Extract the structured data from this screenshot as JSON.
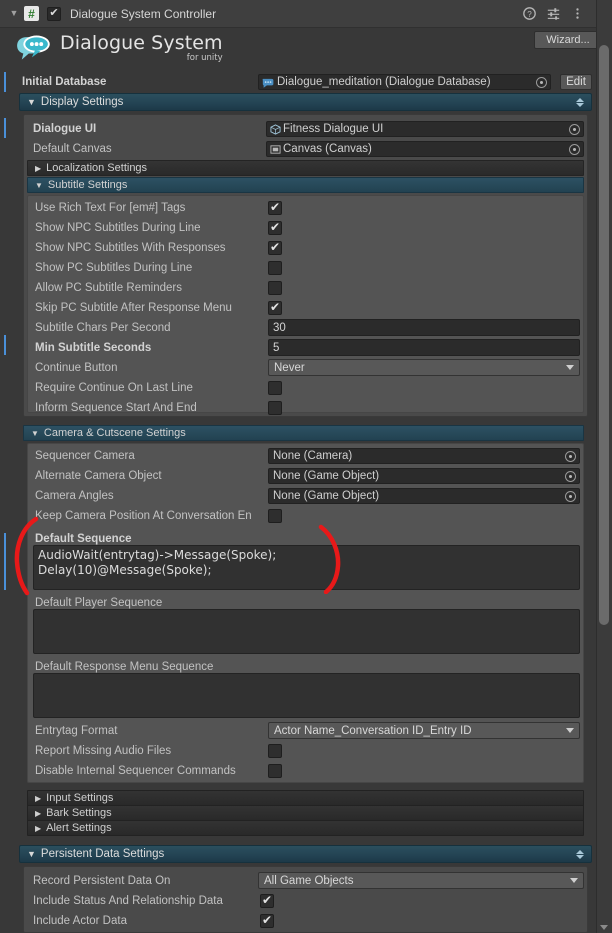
{
  "component": {
    "title": "Dialogue System Controller",
    "script_icon": "csharp-script-icon",
    "enabled": true,
    "help_icon": "help-icon",
    "preset_icon": "preset-settings-icon",
    "menu_icon": "kebab-menu-icon"
  },
  "logo": {
    "main": "Dialogue System",
    "sub": "for unity",
    "icon": "speech-bubble-logo"
  },
  "wizard_button": "Wizard...",
  "initial_database": {
    "label": "Initial Database",
    "value": "Dialogue_meditation (Dialogue Database)",
    "asset_icon": "dialogue-database-icon",
    "edit_button": "Edit"
  },
  "display_settings": {
    "header": "Display Settings",
    "dialogue_ui": {
      "label": "Dialogue UI",
      "value": "Fitness Dialogue UI",
      "icon": "prefab-icon"
    },
    "default_canvas": {
      "label": "Default Canvas",
      "value": "Canvas (Canvas)",
      "icon": "gameobject-icon"
    },
    "localization_settings": "Localization Settings",
    "subtitle_settings": "Subtitle Settings",
    "subtitle_rows": [
      {
        "label": "Use Rich Text For [em#] Tags",
        "type": "checkbox",
        "value": true
      },
      {
        "label": "Show NPC Subtitles During Line",
        "type": "checkbox",
        "value": true
      },
      {
        "label": "Show NPC Subtitles With Responses",
        "type": "checkbox",
        "value": true
      },
      {
        "label": "Show PC Subtitles During Line",
        "type": "checkbox",
        "value": false
      },
      {
        "label": "Allow PC Subtitle Reminders",
        "type": "checkbox",
        "value": false
      },
      {
        "label": "Skip PC Subtitle After Response Menu",
        "type": "checkbox",
        "value": true
      },
      {
        "label": "Subtitle Chars Per Second",
        "type": "text",
        "value": "30"
      },
      {
        "label": "Min Subtitle Seconds",
        "type": "text",
        "value": "5",
        "bold": true
      },
      {
        "label": "Continue Button",
        "type": "popup",
        "value": "Never"
      },
      {
        "label": "Require Continue On Last Line",
        "type": "checkbox",
        "value": false
      },
      {
        "label": "Inform Sequence Start And End",
        "type": "checkbox",
        "value": false
      }
    ]
  },
  "camera_settings": {
    "header": "Camera & Cutscene Settings",
    "sequencer_camera": {
      "label": "Sequencer Camera",
      "value": "None (Camera)"
    },
    "alternate_camera_object": {
      "label": "Alternate Camera Object",
      "value": "None (Game Object)"
    },
    "camera_angles": {
      "label": "Camera Angles",
      "value": "None (Game Object)"
    },
    "keep_camera_position": {
      "label": "Keep Camera Position At Conversation En",
      "value": false
    },
    "default_sequence": {
      "label": "Default Sequence",
      "value": "AudioWait(entrytag)->Message(Spoke);\nDelay(10)@Message(Spoke);",
      "line1": "AudioWait(entrytag)->Message(Spoke);",
      "line2": "Delay(10)@Message(Spoke);"
    },
    "default_player_sequence": {
      "label": "Default Player Sequence",
      "value": ""
    },
    "default_response_menu_sequence": {
      "label": "Default Response Menu Sequence",
      "value": ""
    },
    "entrytag_format": {
      "label": "Entrytag Format",
      "value": "Actor Name_Conversation ID_Entry ID"
    },
    "report_missing_audio": {
      "label": "Report Missing Audio Files",
      "value": false
    },
    "disable_internal_sequencer": {
      "label": "Disable Internal Sequencer Commands",
      "value": false
    }
  },
  "collapsed_sections": [
    "Input Settings",
    "Bark Settings",
    "Alert Settings"
  ],
  "persistent_data_settings": {
    "header": "Persistent Data Settings",
    "record_on": {
      "label": "Record Persistent Data On",
      "value": "All Game Objects"
    },
    "include_status": {
      "label": "Include Status And Relationship Data",
      "value": true
    },
    "include_actor": {
      "label": "Include Actor Data",
      "value": true
    }
  },
  "colors": {
    "panel_bg": "#383838",
    "section_header": "#244454",
    "accent_logo": "#5ec8d8",
    "override_bar": "#4a90d9",
    "annotation": "#e81919"
  }
}
